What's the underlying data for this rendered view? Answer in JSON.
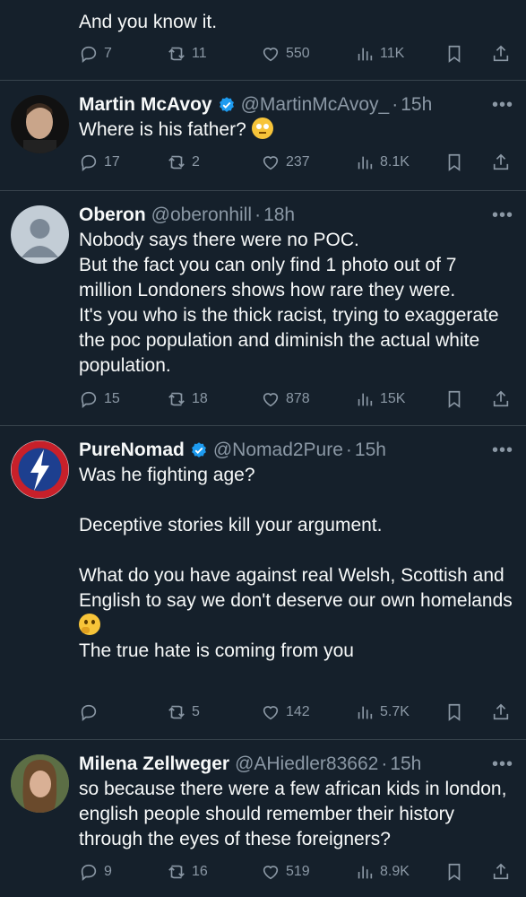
{
  "posts": [
    {
      "text": "And you know it.",
      "replies": "7",
      "reposts": "11",
      "likes": "550",
      "views": "11K"
    },
    {
      "name": "Martin McAvoy",
      "handle": "@MartinMcAvoy_",
      "time": "15h",
      "text": "Where is his father?",
      "replies": "17",
      "reposts": "2",
      "likes": "237",
      "views": "8.1K"
    },
    {
      "name": "Oberon",
      "handle": "@oberonhill",
      "time": "18h",
      "text": "Nobody says there were no POC.\nBut the fact you can only find 1 photo out of 7 million Londoners shows how rare they were.\nIt's you who is the thick racist, trying to exaggerate the poc population and diminish the actual white population.",
      "replies": "15",
      "reposts": "18",
      "likes": "878",
      "views": "15K"
    },
    {
      "name": "PureNomad",
      "handle": "@Nomad2Pure",
      "time": "15h",
      "text1": "Was he fighting age?\n\nDeceptive stories kill your argument.\n\nWhat do you have against real Welsh, Scottish and English to say we don't deserve our own homelands",
      "text2": "The true hate is coming from you",
      "replies": "",
      "reposts": "5",
      "likes": "142",
      "views": "5.7K"
    },
    {
      "name": "Milena Zellweger",
      "handle": "@AHiedler83662",
      "time": "15h",
      "text": "so because there were a few african kids in london, english people should remember their history through the eyes of these foreigners?",
      "replies": "9",
      "reposts": "16",
      "likes": "519",
      "views": "8.9K"
    }
  ],
  "colors": {
    "background": "#15202b",
    "text": "#f7f9f9",
    "secondary": "#8b98a5",
    "verified": "#1d9bf0",
    "divider": "#38444d"
  },
  "icons": [
    "reply-icon",
    "repost-icon",
    "like-icon",
    "views-icon",
    "bookmark-icon",
    "share-icon",
    "verified-icon",
    "more-icon"
  ]
}
